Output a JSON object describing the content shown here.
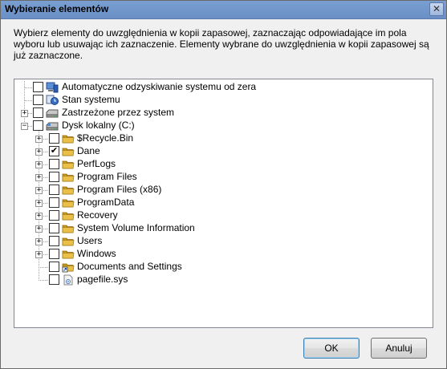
{
  "window": {
    "title": "Wybieranie elementów",
    "close_glyph": "✕"
  },
  "description": "Wybierz elementy do uwzględnienia w kopii zapasowej, zaznaczając odpowiadające im pola wyboru lub usuwając ich zaznaczenie. Elementy wybrane do uwzględnienia w kopii zapasowej są już zaznaczone.",
  "tree": {
    "items": [
      {
        "label": "Automatyczne odzyskiwanie systemu od zera",
        "checked": false,
        "icon": "bare-metal-recovery-icon",
        "has_expander": false
      },
      {
        "label": "Stan systemu",
        "checked": false,
        "icon": "system-state-icon",
        "has_expander": false
      },
      {
        "label": "Zastrzeżone przez system",
        "checked": false,
        "icon": "system-reserved-drive-icon",
        "has_expander": true,
        "expanded": false
      },
      {
        "label": "Dysk lokalny (C:)",
        "checked": false,
        "icon": "local-disk-icon",
        "has_expander": true,
        "expanded": true
      }
    ],
    "children": [
      {
        "label": "$Recycle.Bin",
        "checked": false,
        "icon": "folder-icon",
        "has_expander": true
      },
      {
        "label": "Dane",
        "checked": true,
        "icon": "folder-icon",
        "has_expander": true
      },
      {
        "label": "PerfLogs",
        "checked": false,
        "icon": "folder-icon",
        "has_expander": true
      },
      {
        "label": "Program Files",
        "checked": false,
        "icon": "folder-icon",
        "has_expander": true
      },
      {
        "label": "Program Files (x86)",
        "checked": false,
        "icon": "folder-icon",
        "has_expander": true
      },
      {
        "label": "ProgramData",
        "checked": false,
        "icon": "folder-icon",
        "has_expander": true
      },
      {
        "label": "Recovery",
        "checked": false,
        "icon": "folder-icon",
        "has_expander": true
      },
      {
        "label": "System Volume Information",
        "checked": false,
        "icon": "folder-icon",
        "has_expander": true
      },
      {
        "label": "Users",
        "checked": false,
        "icon": "folder-icon",
        "has_expander": true
      },
      {
        "label": "Windows",
        "checked": false,
        "icon": "folder-icon",
        "has_expander": true
      },
      {
        "label": "Documents and Settings",
        "checked": false,
        "icon": "folder-shortcut-icon",
        "has_expander": false
      },
      {
        "label": "pagefile.sys",
        "checked": false,
        "icon": "system-file-icon",
        "has_expander": false
      }
    ],
    "expander_collapsed": "+",
    "expander_expanded": "−",
    "check_mark": "✔"
  },
  "buttons": {
    "ok": "OK",
    "cancel": "Anuluj"
  },
  "colors": {
    "folder": "#e8c04a",
    "folder_dark": "#c99a1c",
    "titlebar": "#7a9fd1"
  }
}
